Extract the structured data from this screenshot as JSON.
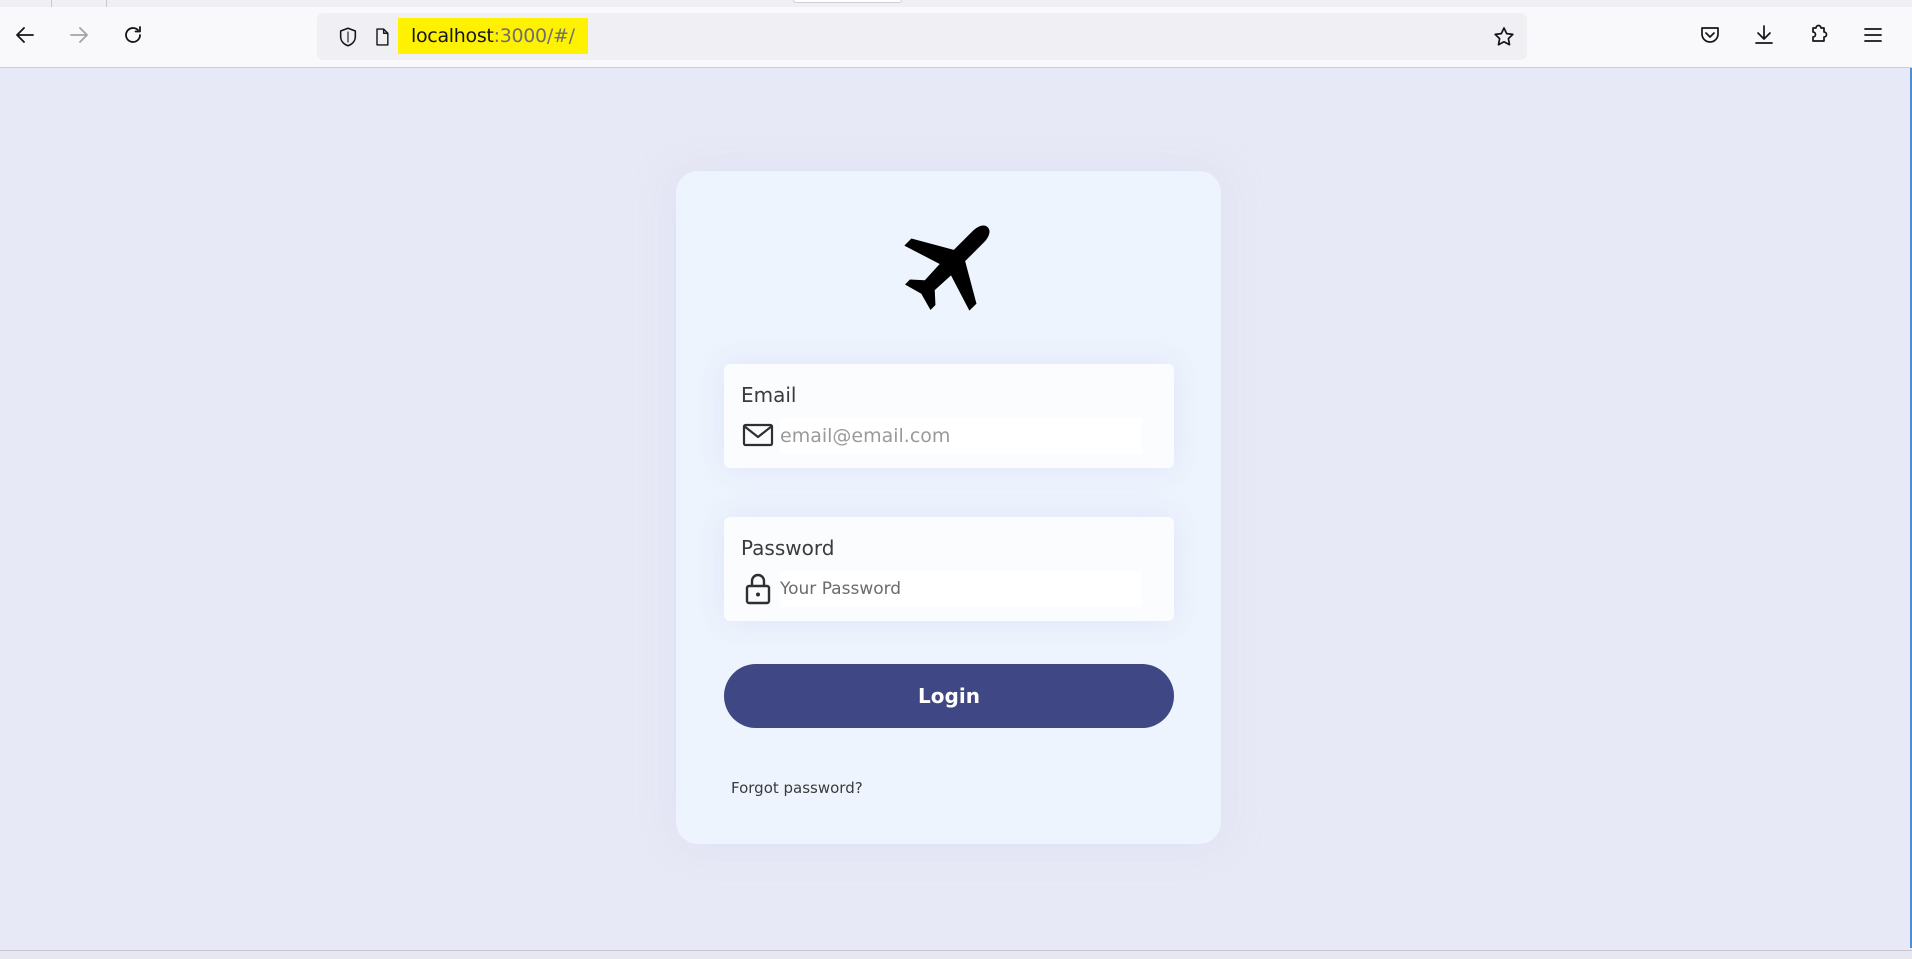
{
  "browser": {
    "url_host": "localhost",
    "url_rest": ":3000/#/",
    "icons": {
      "back": "arrow-left-icon",
      "forward": "arrow-right-icon",
      "reload": "reload-icon",
      "tracking_protection": "shield-icon",
      "page_info": "page-icon",
      "bookmark": "star-icon",
      "pocket": "pocket-icon",
      "downloads": "download-icon",
      "extensions": "puzzle-icon",
      "menu": "hamburger-menu-icon"
    }
  },
  "login": {
    "logo_icon": "airplane-icon",
    "email": {
      "label": "Email",
      "placeholder": "email@email.com",
      "icon": "envelope-icon"
    },
    "password": {
      "label": "Password",
      "placeholder": "Your Password",
      "icon": "lock-icon"
    },
    "submit_label": "Login",
    "forgot_label": "Forgot password?"
  },
  "colors": {
    "page_background": "#e8e9f6",
    "card_background": "#eef4fd",
    "button_background": "#3f4785",
    "url_highlight": "#fff200"
  }
}
